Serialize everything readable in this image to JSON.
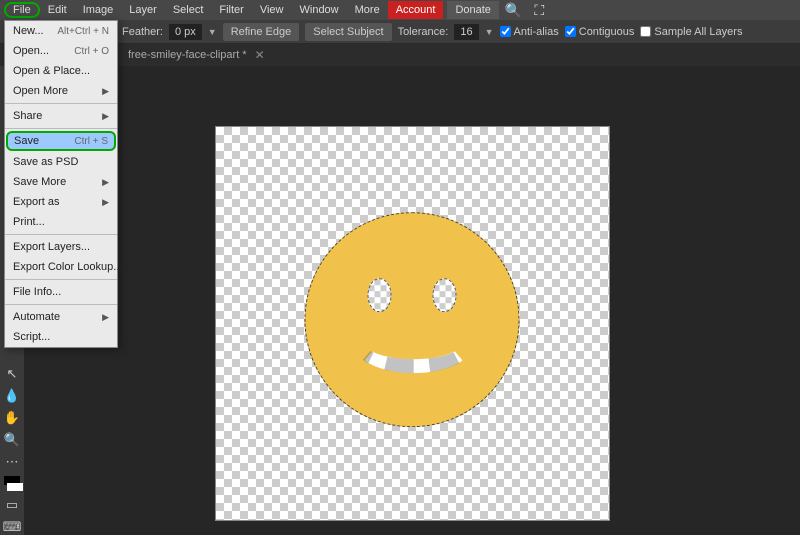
{
  "menubar": {
    "items": [
      "File",
      "Edit",
      "Image",
      "Layer",
      "Select",
      "Filter",
      "View",
      "Window",
      "More"
    ],
    "account": "Account",
    "donate": "Donate"
  },
  "options": {
    "feather_label": "Feather:",
    "feather_value": "0 px",
    "refine_edge": "Refine Edge",
    "select_subject": "Select Subject",
    "tolerance_label": "Tolerance:",
    "tolerance_value": "16",
    "anti_alias": "Anti-alias",
    "contiguous": "Contiguous",
    "sample_all": "Sample All Layers",
    "anti_alias_checked": true,
    "contiguous_checked": true,
    "sample_all_checked": false
  },
  "tab": {
    "title": "free-smiley-face-clipart *"
  },
  "dropdown": {
    "items": [
      {
        "label": "New...",
        "shortcut": "Alt+Ctrl + N",
        "type": "item"
      },
      {
        "label": "Open...",
        "shortcut": "Ctrl + O",
        "type": "item"
      },
      {
        "label": "Open & Place...",
        "type": "item"
      },
      {
        "label": "Open More",
        "type": "submenu"
      },
      {
        "type": "sep"
      },
      {
        "label": "Share",
        "type": "submenu"
      },
      {
        "type": "sep"
      },
      {
        "label": "Save",
        "shortcut": "Ctrl + S",
        "type": "item",
        "highlight": true
      },
      {
        "label": "Save as PSD",
        "type": "item"
      },
      {
        "label": "Save More",
        "type": "submenu"
      },
      {
        "label": "Export as",
        "type": "submenu"
      },
      {
        "label": "Print...",
        "type": "item"
      },
      {
        "type": "sep"
      },
      {
        "label": "Export Layers...",
        "type": "item"
      },
      {
        "label": "Export Color Lookup...",
        "type": "item"
      },
      {
        "type": "sep"
      },
      {
        "label": "File Info...",
        "type": "item"
      },
      {
        "type": "sep"
      },
      {
        "label": "Automate",
        "type": "submenu"
      },
      {
        "label": "Script...",
        "type": "item"
      }
    ]
  },
  "colors": {
    "accent": "#f1c24b",
    "highlight_border": "#00aa00"
  }
}
